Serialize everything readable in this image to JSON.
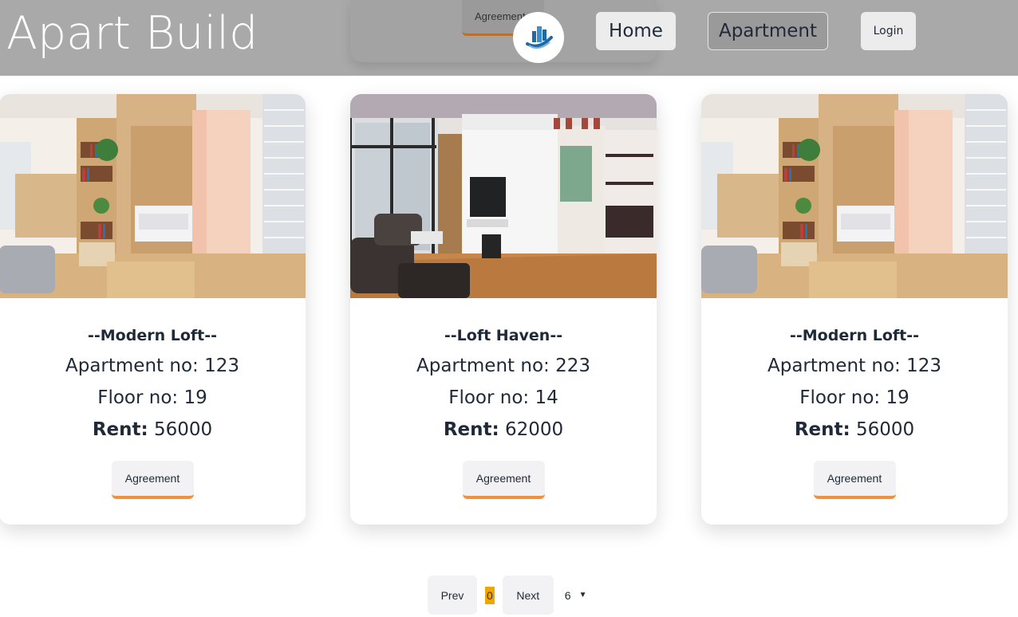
{
  "header": {
    "brand": "Apart Build",
    "ghost_button_label": "Agreement",
    "nav": {
      "home": "Home",
      "apartment": "Apartment",
      "login": "Login"
    }
  },
  "cards": [
    {
      "name": "--Modern Loft--",
      "apartment": "Apartment no: 123",
      "floor": "Floor no: 19",
      "rent_label": "Rent:",
      "rent_value": "56000",
      "button": "Agreement"
    },
    {
      "name": "--Loft Haven--",
      "apartment": "Apartment no: 223",
      "floor": "Floor no: 14",
      "rent_label": "Rent:",
      "rent_value": "62000",
      "button": "Agreement"
    },
    {
      "name": "--Modern Loft--",
      "apartment": "Apartment no: 123",
      "floor": "Floor no: 19",
      "rent_label": "Rent:",
      "rent_value": "56000",
      "button": "Agreement"
    }
  ],
  "pagination": {
    "prev": "Prev",
    "current": "0",
    "next": "Next",
    "per_page": "6"
  },
  "colors": {
    "header_bg": "#a9a9a9",
    "accent_underline": "#f0913f",
    "current_page_bg": "#f0a500"
  },
  "icons": [
    "building-logo-icon",
    "chevron-down-icon"
  ]
}
